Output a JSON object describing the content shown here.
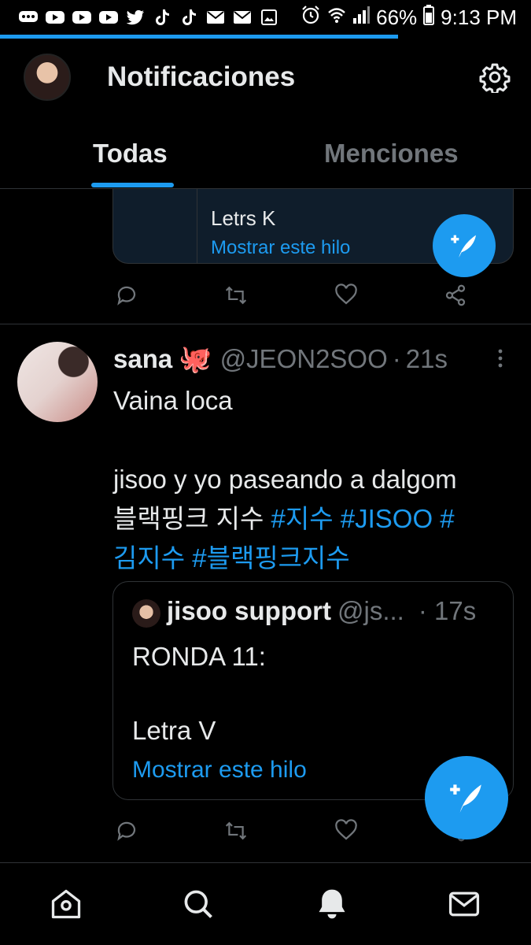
{
  "status_bar": {
    "battery": "66%",
    "time": "9:13 PM",
    "notification_icons": [
      "chat-icon",
      "youtube-icon",
      "youtube-icon",
      "youtube-icon",
      "twitter-icon",
      "tiktok-icon",
      "tiktok-icon",
      "mail-icon",
      "mail-icon",
      "image-icon"
    ],
    "system_icons": [
      "alarm-icon",
      "wifi-icon",
      "signal-icon",
      "battery-icon"
    ]
  },
  "header": {
    "title": "Notificaciones",
    "settings_icon": "gear-icon"
  },
  "tabs": [
    {
      "label": "Todas",
      "active": true
    },
    {
      "label": "Menciones",
      "active": false
    }
  ],
  "previous_tweet": {
    "quote_text": "Letrs K",
    "show_thread": "Mostrar este hilo"
  },
  "tweet": {
    "name": "sana",
    "emoji": "🐙",
    "handle": "@JEON2SOO",
    "separator": "·",
    "time": "21s",
    "line1": "Vaina loca",
    "line2": "jisoo y yo paseando a dalgom",
    "line3_text": "블랙핑크 지수 ",
    "line3_tags": "#지수 #JISOO #",
    "line4_tags": "김지수 #블랙핑크지수",
    "quote": {
      "name": "jisoo support",
      "handle": "@js...",
      "time": "· 17s",
      "text1": "RONDA 11:",
      "text2": "Letra V",
      "show_thread": "Mostrar este hilo"
    }
  },
  "actions": [
    "reply-icon",
    "retweet-icon",
    "like-icon",
    "share-icon"
  ],
  "bottom_nav": [
    "home-icon",
    "search-icon",
    "bell-icon",
    "mail-icon"
  ],
  "colors": {
    "accent": "#1d9bf0",
    "background": "#000000",
    "secondary_text": "#71767b",
    "border": "#2f3336"
  }
}
